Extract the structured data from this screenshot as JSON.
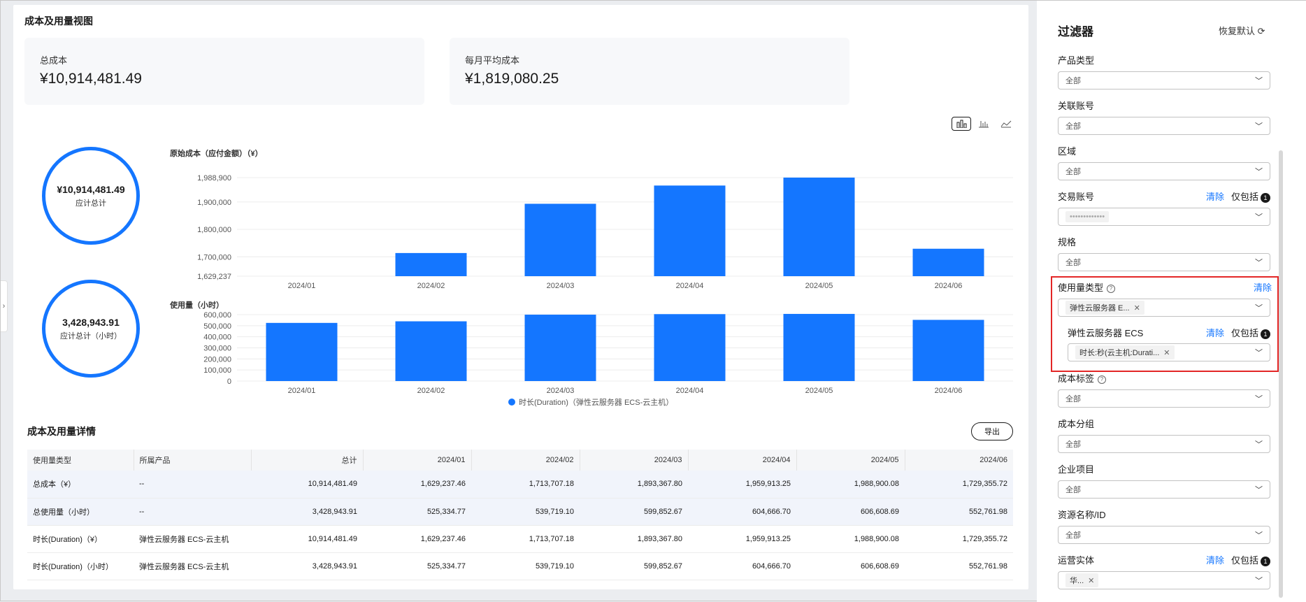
{
  "overview": {
    "title": "成本及用量视图",
    "total_cost_label": "总成本",
    "total_cost_value": "¥10,914,481.49",
    "monthly_avg_label": "每月平均成本",
    "monthly_avg_value": "¥1,819,080.25",
    "donut_cost_value": "¥10,914,481.49",
    "donut_cost_label": "应计总计",
    "donut_usage_value": "3,428,943.91",
    "donut_usage_label": "应计总计（小时）"
  },
  "chart_data": [
    {
      "type": "bar",
      "title": "原始成本（应付金额）（¥）",
      "categories": [
        "2024/01",
        "2024/02",
        "2024/03",
        "2024/04",
        "2024/05",
        "2024/06"
      ],
      "values": [
        1629237.46,
        1713707.18,
        1893367.8,
        1959913.25,
        1988900.08,
        1729355.72
      ],
      "yticks": [
        "1,629,237",
        "1,700,000",
        "1,800,000",
        "1,900,000",
        "1,988,900"
      ],
      "yticks_values": [
        1629237,
        1700000,
        1800000,
        1900000,
        1988900
      ],
      "ylim": [
        1629237,
        1988900
      ],
      "color": "#1476ff"
    },
    {
      "type": "bar",
      "title": "使用量（小时）",
      "categories": [
        "2024/01",
        "2024/02",
        "2024/03",
        "2024/04",
        "2024/05",
        "2024/06"
      ],
      "values": [
        525334.77,
        539719.1,
        599852.67,
        604666.7,
        606608.69,
        552761.98
      ],
      "yticks": [
        "0",
        "100,000",
        "200,000",
        "300,000",
        "400,000",
        "500,000",
        "600,000"
      ],
      "yticks_values": [
        0,
        100000,
        200000,
        300000,
        400000,
        500000,
        600000
      ],
      "ylim": [
        0,
        600000
      ],
      "legend": "时长(Duration)（弹性云服务器 ECS-云主机）",
      "color": "#1476ff"
    }
  ],
  "details": {
    "title": "成本及用量详情",
    "export_label": "导出",
    "headers": [
      "使用量类型",
      "所属产品",
      "总计",
      "2024/01",
      "2024/02",
      "2024/03",
      "2024/04",
      "2024/05",
      "2024/06"
    ],
    "rows": [
      [
        "总成本（¥）",
        "--",
        "10,914,481.49",
        "1,629,237.46",
        "1,713,707.18",
        "1,893,367.80",
        "1,959,913.25",
        "1,988,900.08",
        "1,729,355.72"
      ],
      [
        "总使用量（小时）",
        "--",
        "3,428,943.91",
        "525,334.77",
        "539,719.10",
        "599,852.67",
        "604,666.70",
        "606,608.69",
        "552,761.98"
      ],
      [
        "时长(Duration)（¥）",
        "弹性云服务器 ECS-云主机",
        "10,914,481.49",
        "1,629,237.46",
        "1,713,707.18",
        "1,893,367.80",
        "1,959,913.25",
        "1,988,900.08",
        "1,729,355.72"
      ],
      [
        "时长(Duration)（小时）",
        "弹性云服务器 ECS-云主机",
        "3,428,943.91",
        "525,334.77",
        "539,719.10",
        "599,852.67",
        "604,666.70",
        "606,608.69",
        "552,761.98"
      ]
    ]
  },
  "filter": {
    "title": "过滤器",
    "reset_label": "恢复默认",
    "clear_label": "清除",
    "include_label": "仅包括",
    "include_count": "1",
    "all_label": "全部",
    "product_type": "产品类型",
    "linked_account": "关联账号",
    "region": "区域",
    "trade_account": "交易账号",
    "trade_account_value": "•••••••••••••",
    "spec": "规格",
    "usage_type": "使用量类型",
    "usage_type_tag": "弹性云服务器 E...",
    "ecs_label": "弹性云服务器 ECS",
    "ecs_tag": "时长:秒(云主机:Durati...",
    "cost_tag": "成本标签",
    "cost_group": "成本分组",
    "enterprise_project": "企业项目",
    "resource_name": "资源名称/ID",
    "operator": "运营实体",
    "operator_tag": "华..."
  }
}
